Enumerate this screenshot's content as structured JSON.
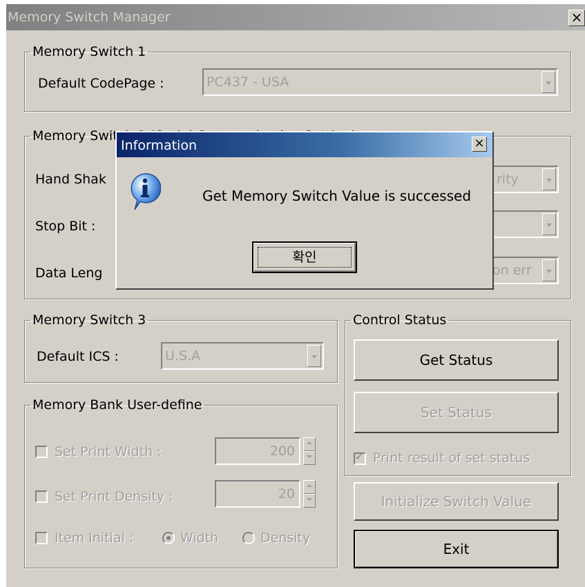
{
  "window": {
    "title": "Memory Switch Manager",
    "close_glyph": "×"
  },
  "group1": {
    "legend": "Memory Switch 1",
    "codepage_label": "Default CodePage  :",
    "codepage_value": "PC437 - USA"
  },
  "group2": {
    "legend": "Memory Switch 2 (Serial Communication Setting)",
    "handshake_label": "Hand Shak",
    "handshake_value": "rity",
    "stopbit_label": "Stop Bit :",
    "stopbit_value": "",
    "datalength_label": "Data Leng",
    "datalength_value": "on err"
  },
  "group3": {
    "legend": "Memory Switch 3",
    "ics_label": "Default ICS :",
    "ics_value": "U.S.A"
  },
  "control_status": {
    "legend": "Control Status",
    "get_status": "Get Status",
    "set_status": "Set Status",
    "print_result_label": "Print result of set status",
    "print_result_checked": true
  },
  "memory_bank": {
    "legend": "Memory Bank User-define",
    "print_width_label": "Set Print Width :",
    "print_width_value": "200",
    "print_density_label": "Set Print Density :",
    "print_density_value": "20",
    "item_initial_label": "Item Initial :",
    "width_option": "Width",
    "density_option": "Density",
    "selected_option": "Width"
  },
  "buttons": {
    "initialize": "Initialize Switch Value",
    "exit": "Exit"
  },
  "dialog": {
    "title": "Information",
    "close_glyph": "×",
    "message": "Get Memory Switch Value is successed",
    "ok_label": "확인",
    "icon": "info-icon"
  }
}
